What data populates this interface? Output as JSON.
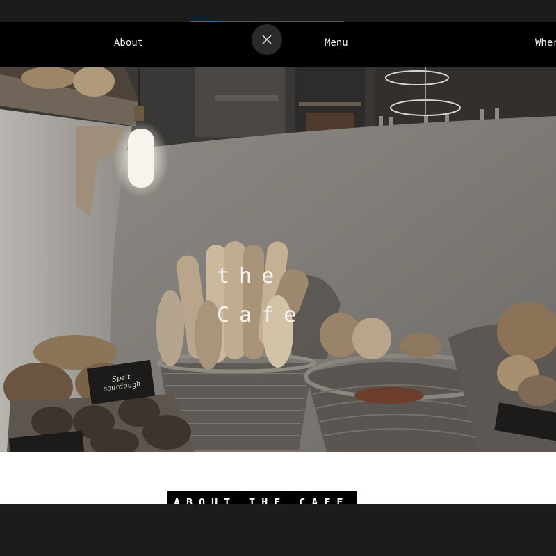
{
  "progress": 0.2,
  "nav": {
    "about": "About",
    "menu": "Menu",
    "where": "Wher"
  },
  "hero": {
    "title_line1": "the",
    "title_line2": "Cafe",
    "signs": {
      "sourdough_line1": "Spelt",
      "sourdough_line2": "sourdough"
    }
  },
  "section": {
    "heading": "ABOUT THE CAFE"
  },
  "icons": {
    "close": "close-icon"
  }
}
